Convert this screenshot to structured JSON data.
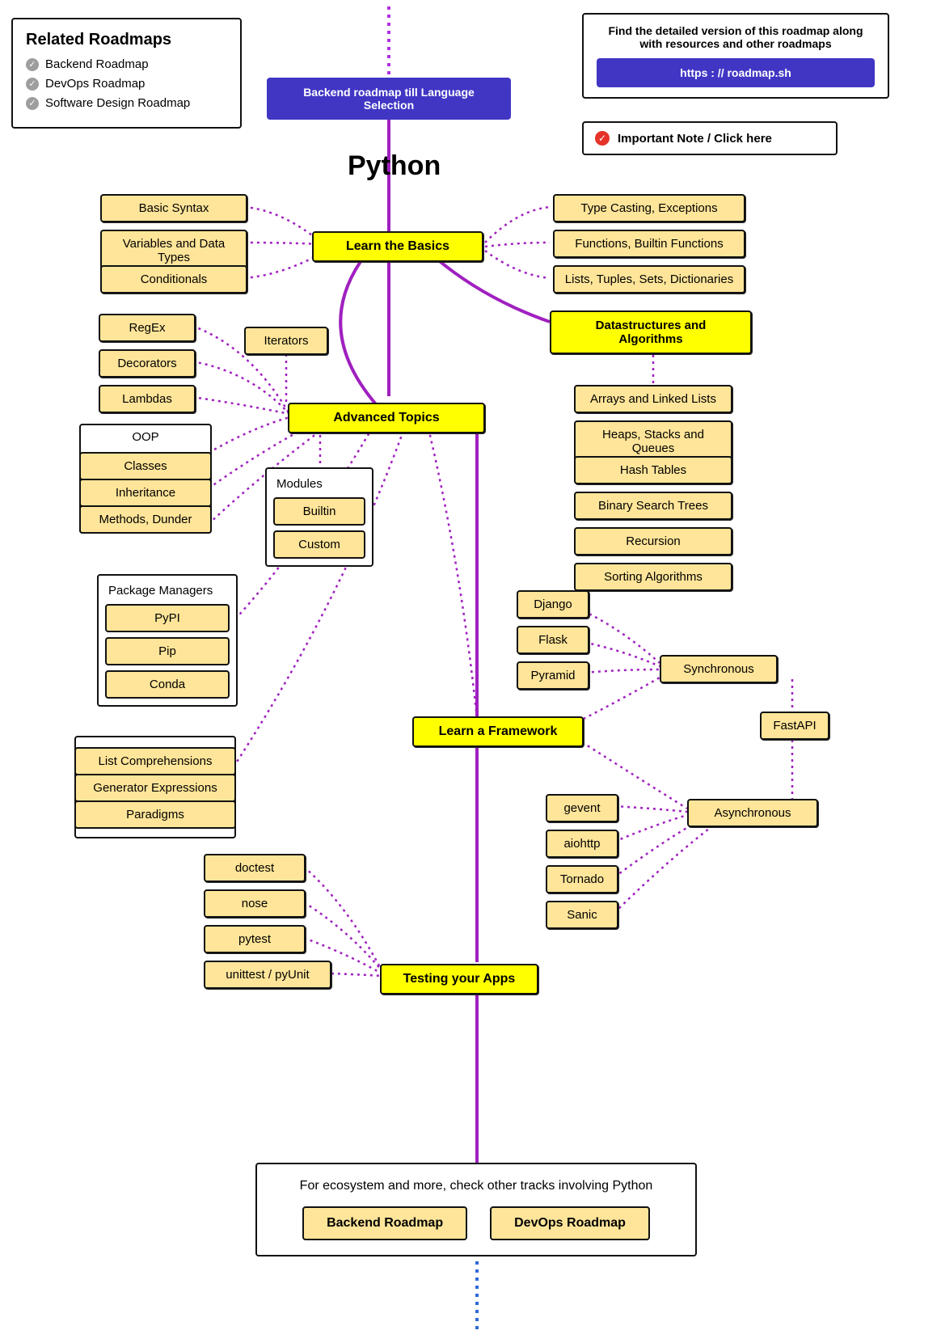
{
  "related": {
    "heading": "Related Roadmaps",
    "items": [
      "Backend Roadmap",
      "DevOps Roadmap",
      "Software Design Roadmap"
    ]
  },
  "topBanner": {
    "text": "Find the detailed version of this roadmap along with resources and other roadmaps",
    "link": "https : // roadmap.sh"
  },
  "startLink": "Backend roadmap till Language Selection",
  "importantNote": "Important Note / Click here",
  "title": "Python",
  "basics": {
    "main": "Learn the Basics",
    "left": [
      "Basic Syntax",
      "Variables and Data Types",
      "Conditionals"
    ],
    "right": [
      "Type Casting, Exceptions",
      "Functions, Builtin Functions",
      "Lists, Tuples, Sets, Dictionaries"
    ]
  },
  "ds": {
    "main": "Datastructures and Algorithms",
    "items": [
      "Arrays and Linked Lists",
      "Heaps, Stacks and Queues",
      "Hash Tables",
      "Binary Search Trees",
      "Recursion",
      "Sorting Algorithms"
    ]
  },
  "adv": {
    "main": "Advanced Topics",
    "left": [
      "RegEx",
      "Decorators",
      "Lambdas"
    ],
    "iterators": "Iterators",
    "oop": {
      "label": "OOP",
      "items": [
        "Classes",
        "Inheritance",
        "Methods, Dunder"
      ]
    },
    "modules": {
      "label": "Modules",
      "items": [
        "Builtin",
        "Custom"
      ]
    },
    "pkg": {
      "label": "Package Managers",
      "items": [
        "PyPI",
        "Pip",
        "Conda"
      ]
    },
    "extra": {
      "items": [
        "List Comprehensions",
        "Generator Expressions",
        "Paradigms"
      ]
    }
  },
  "fw": {
    "main": "Learn a Framework",
    "sync_label": "Synchronous",
    "async_label": "Asynchronous",
    "sync": [
      "Django",
      "Flask",
      "Pyramid"
    ],
    "fastapi": "FastAPI",
    "async": [
      "gevent",
      "aiohttp",
      "Tornado",
      "Sanic"
    ]
  },
  "test": {
    "main": "Testing your Apps",
    "items": [
      "doctest",
      "nose",
      "pytest",
      "unittest / pyUnit"
    ]
  },
  "ecosystem": {
    "text": "For ecosystem and more, check other tracks involving Python",
    "btns": [
      "Backend Roadmap",
      "DevOps Roadmap"
    ]
  }
}
